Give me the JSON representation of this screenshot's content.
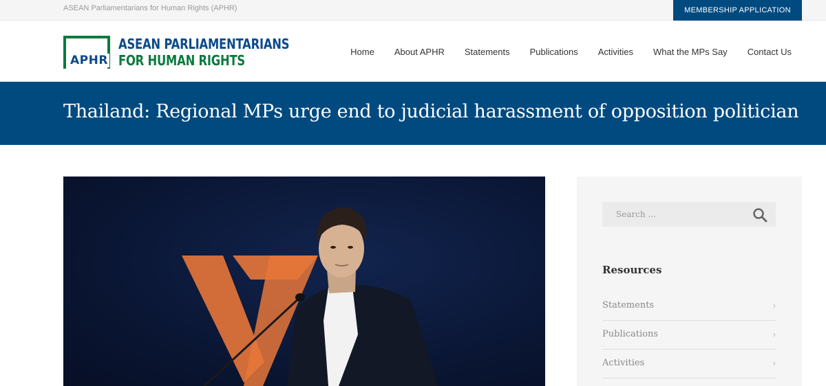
{
  "topbar": {
    "tagline": "ASEAN Parliamentarians for Human Rights (APHR)",
    "membership_label": "MEMBERSHIP APPLICATION"
  },
  "logo": {
    "abbr": "APHR",
    "line1": "ASEAN PARLIAMENTARIANS",
    "line2": "FOR HUMAN RIGHTS"
  },
  "nav": {
    "items": [
      {
        "label": "Home"
      },
      {
        "label": "About APHR"
      },
      {
        "label": "Statements"
      },
      {
        "label": "Publications"
      },
      {
        "label": "Activities"
      },
      {
        "label": "What the MPs Say"
      },
      {
        "label": "Contact Us"
      }
    ]
  },
  "hero": {
    "title": "Thailand: Regional MPs urge end to judicial harassment of opposition politician"
  },
  "sidebar": {
    "search_placeholder": "Search …",
    "resources_title": "Resources",
    "resources": [
      {
        "label": "Statements"
      },
      {
        "label": "Publications"
      },
      {
        "label": "Activities"
      }
    ]
  },
  "colors": {
    "brand_blue": "#004a80",
    "logo_green": "#0b7a3e",
    "logo_blue": "#0b4a8a"
  },
  "icons": {
    "search": "search-icon",
    "chevron": "chevron-right-icon"
  }
}
